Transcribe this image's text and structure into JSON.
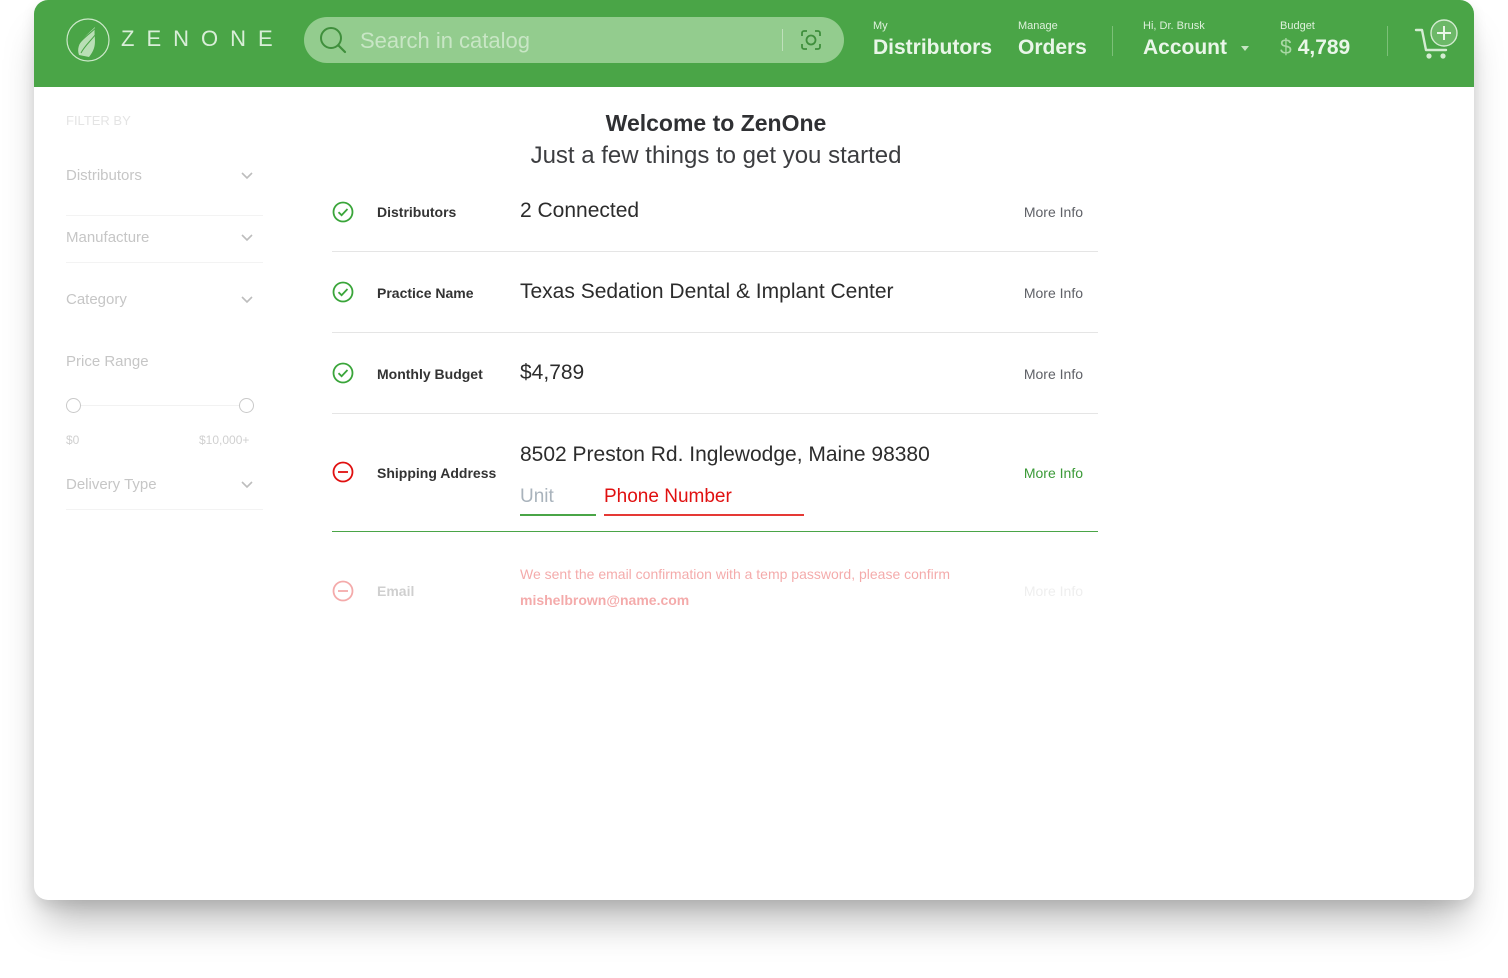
{
  "header": {
    "brand": "ZENONE",
    "search_placeholder": "Search in catalog",
    "nav": [
      {
        "small": "My",
        "big": "Distributors"
      },
      {
        "small": "Manage",
        "big": "Orders"
      },
      {
        "small": "Hi, Dr. Brusk",
        "big": "Account"
      },
      {
        "small": "Budget",
        "currency": "$",
        "big": "4,789"
      }
    ]
  },
  "sidebar": {
    "filter_by": "FILTER BY",
    "filters": [
      "Distributors",
      "Manufacture",
      "Category"
    ],
    "price_range": {
      "label": "Price Range",
      "min": "$0",
      "max": "$10,000+"
    },
    "delivery_type": "Delivery Type"
  },
  "main": {
    "title": "Welcome to ZenOne",
    "subtitle": "Just a few things to get you started",
    "rows": [
      {
        "label": "Distributors",
        "value": "2 Connected",
        "more": "More Info",
        "status": "complete"
      },
      {
        "label": "Practice Name",
        "value": "Texas Sedation Dental & Implant Center",
        "more": "More Info",
        "status": "complete"
      },
      {
        "label": "Monthly Budget",
        "value": "$4,789",
        "more": "More Info",
        "status": "complete"
      },
      {
        "label": "Shipping Address",
        "value": "8502 Preston Rd. Inglewodge, Maine 98380",
        "more": "More Info",
        "status": "incomplete",
        "unit_placeholder": "Unit",
        "phone_placeholder": "Phone Number"
      }
    ],
    "email": {
      "label": "Email",
      "message": "We sent the email confirmation with a temp password, please confirm",
      "address": "mishelbrown@name.com",
      "more": "More Info"
    }
  },
  "colors": {
    "brand_green": "#4aa547",
    "error_red": "#e01010",
    "check_green": "#3aa53a"
  }
}
